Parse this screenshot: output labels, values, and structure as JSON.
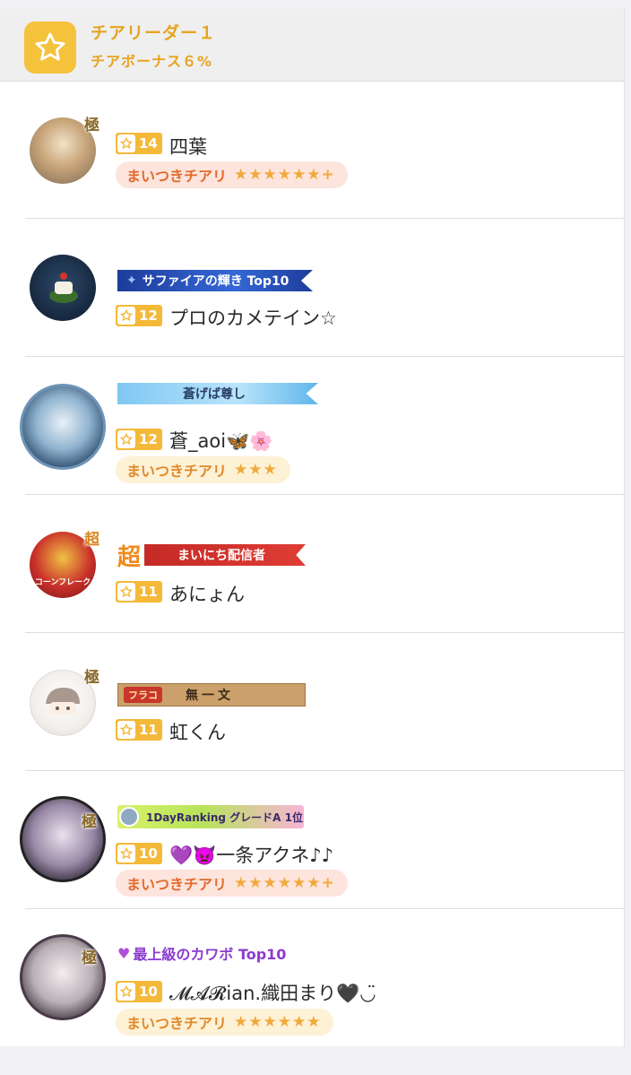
{
  "header": {
    "tier_title": "チアリーダー１",
    "tier_bonus": "チアボーナス６%"
  },
  "users": [
    {
      "level": "14",
      "name": "四葉",
      "mark": "極",
      "cheer_label": "まいつきチアリ",
      "cheer_stars": "★★★★★★+"
    },
    {
      "level": "12",
      "name": "プロのカメテイン☆",
      "banner": "サファイアの輝き Top10"
    },
    {
      "level": "12",
      "name": "蒼_aoi🦋🌸",
      "banner": "蒼げば尊し",
      "cheer_label": "まいつきチアリ",
      "cheer_stars": "★★★"
    },
    {
      "level": "11",
      "name": "あにょん",
      "mark": "超",
      "banner_prefix": "超",
      "banner": "まいにち配信者",
      "avatar_caption": "コーンフレーク"
    },
    {
      "level": "11",
      "name": "虹くん",
      "mark": "極",
      "banner_prefix": "フラコ",
      "banner": "無一文"
    },
    {
      "level": "10",
      "name": "💜👿一条アクネ♪♪",
      "mark": "極",
      "banner": "1DayRanking グレードA 1位",
      "cheer_label": "まいつきチアリ",
      "cheer_stars": "★★★★★★+"
    },
    {
      "level": "10",
      "name": "𝓜𝓐𝓡ian.織田まり🖤◡̈",
      "mark": "極",
      "banner": "最上級のカワボ Top10",
      "cheer_label": "まいつきチアリ",
      "cheer_stars": "★★★★★★"
    }
  ]
}
